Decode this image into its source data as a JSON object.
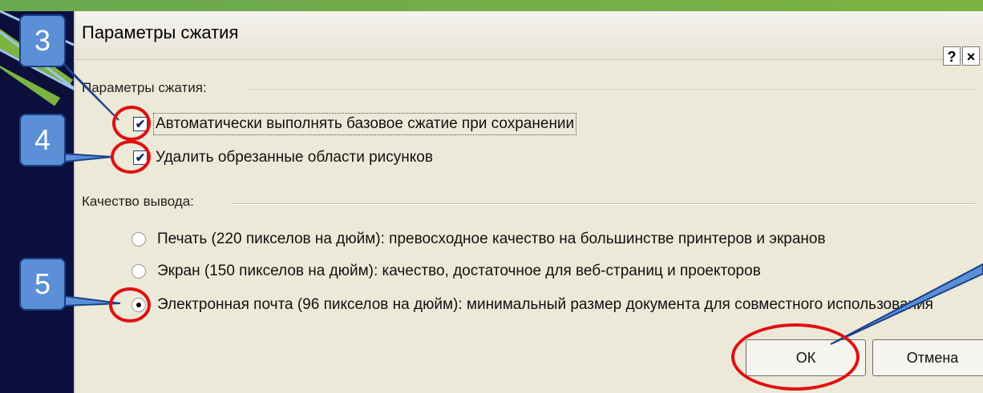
{
  "dialog": {
    "title": "Параметры сжатия",
    "help_label": "?",
    "close_label": "×",
    "compression_group": "Параметры сжатия:",
    "auto_compress_label": "Автоматически выполнять базовое сжатие при сохранении",
    "auto_compress_checked": true,
    "delete_cropped_label": "Удалить обрезанные области рисунков",
    "delete_cropped_checked": true,
    "quality_group": "Качество вывода:",
    "quality_options": [
      {
        "label": "Печать (220 пикселов на дюйм): превосходное качество на большинстве принтеров и экранов",
        "selected": false
      },
      {
        "label": "Экран (150 пикселов на дюйм): качество, достаточное для веб-страниц и проекторов",
        "selected": false
      },
      {
        "label": "Электронная почта (96 пикселов на дюйм): минимальный размер документа для совместного использования",
        "selected": true
      }
    ],
    "ok_label": "ОК",
    "cancel_label": "Отмена"
  },
  "callouts": {
    "c3": "3",
    "c4": "4",
    "c5": "5"
  },
  "check_mark": "✔",
  "colors": {
    "dialog_bg": "#ece9d8",
    "callout_fill": "#5b8fd6",
    "highlight_ring": "#e01010",
    "slide_bg": "#0b1a66"
  }
}
